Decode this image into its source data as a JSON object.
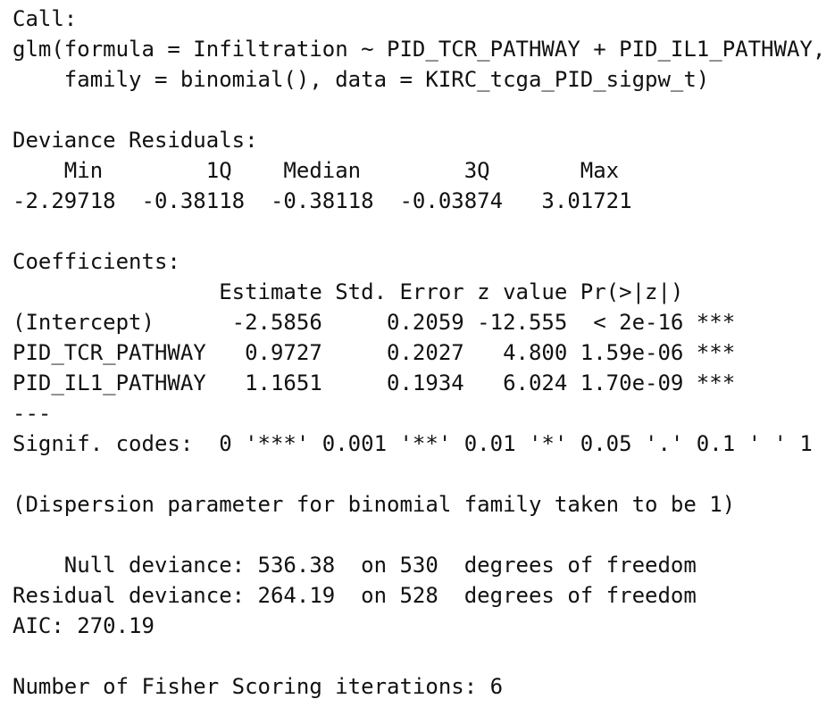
{
  "output": {
    "call_header": "Call:",
    "call_line1": "glm(formula = Infiltration ~ PID_TCR_PATHWAY + PID_IL1_PATHWAY,",
    "call_line2": "    family = binomial(), data = KIRC_tcga_PID_sigpw_t)",
    "deviance_header": "Deviance Residuals:",
    "deviance_cols": "    Min        1Q    Median        3Q       Max  ",
    "deviance_vals": "-2.29718  -0.38118  -0.38118  -0.03874   3.01721  ",
    "coef_header": "Coefficients:",
    "coef_cols": "                Estimate Std. Error z value Pr(>|z|)    ",
    "coef_rows": [
      "(Intercept)      -2.5856     0.2059 -12.555  < 2e-16 ***",
      "PID_TCR_PATHWAY   0.9727     0.2027   4.800 1.59e-06 ***",
      "PID_IL1_PATHWAY   1.1651     0.1934   6.024 1.70e-09 ***"
    ],
    "separator": "---",
    "signif_codes": "Signif. codes:  0 '***' 0.001 '**' 0.01 '*' 0.05 '.' 0.1 ' ' 1",
    "dispersion": "(Dispersion parameter for binomial family taken to be 1)",
    "null_deviance": "    Null deviance: 536.38  on 530  degrees of freedom",
    "residual_deviance": "Residual deviance: 264.19  on 528  degrees of freedom",
    "aic": "AIC: 270.19",
    "fisher": "Number of Fisher Scoring iterations: 6"
  }
}
